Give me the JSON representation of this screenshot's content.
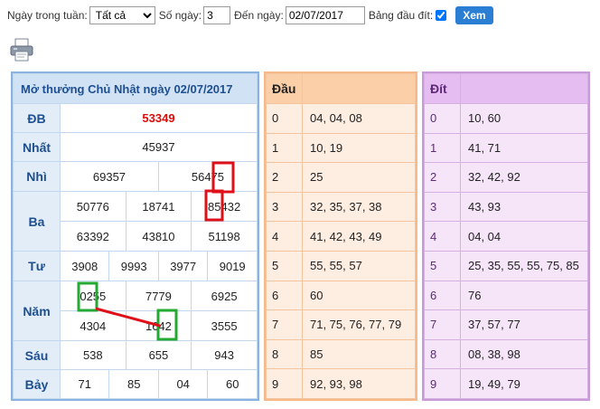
{
  "filter": {
    "day_label": "Ngày trong tuần:",
    "day_selected": "Tất cả",
    "count_label": "Số ngày:",
    "count_value": "3",
    "to_label": "Đến ngày:",
    "to_value": "02/07/2017",
    "dau_dit_label": "Bảng đầu đít:",
    "dau_dit_checked": true,
    "view_button": "Xem"
  },
  "results": {
    "title": "Mở thưởng Chủ Nhật ngày 02/07/2017",
    "prizes": {
      "db": {
        "name": "ĐB",
        "numbers": [
          "53349"
        ]
      },
      "nhat": {
        "name": "Nhất",
        "numbers": [
          "45937"
        ]
      },
      "nhi": {
        "name": "Nhì",
        "numbers": [
          "69357",
          "56475"
        ]
      },
      "ba": {
        "name": "Ba",
        "numbers": [
          "50776",
          "18741",
          "85432",
          "63392",
          "43810",
          "51198"
        ]
      },
      "tu": {
        "name": "Tư",
        "numbers": [
          "3908",
          "9993",
          "3977",
          "9019"
        ]
      },
      "nam": {
        "name": "Năm",
        "numbers": [
          "0255",
          "7779",
          "6925",
          "4304",
          "1642",
          "3555"
        ]
      },
      "sau": {
        "name": "Sáu",
        "numbers": [
          "538",
          "655",
          "943"
        ]
      },
      "bay": {
        "name": "Bảy",
        "numbers": [
          "71",
          "85",
          "04",
          "60"
        ]
      }
    }
  },
  "dau": {
    "header": "Đầu",
    "rows": [
      {
        "k": "0",
        "v": "04, 04, 08"
      },
      {
        "k": "1",
        "v": "10, 19"
      },
      {
        "k": "2",
        "v": "25"
      },
      {
        "k": "3",
        "v": "32, 35, 37, 38"
      },
      {
        "k": "4",
        "v": "41, 42, 43, 49"
      },
      {
        "k": "5",
        "v": "55, 55, 57"
      },
      {
        "k": "6",
        "v": "60"
      },
      {
        "k": "7",
        "v": "71, 75, 76, 77, 79"
      },
      {
        "k": "8",
        "v": "85"
      },
      {
        "k": "9",
        "v": "92, 93, 98"
      }
    ]
  },
  "dit": {
    "header": "Đít",
    "rows": [
      {
        "k": "0",
        "v": "10, 60"
      },
      {
        "k": "1",
        "v": "41, 71"
      },
      {
        "k": "2",
        "v": "32, 42, 92"
      },
      {
        "k": "3",
        "v": "43, 93"
      },
      {
        "k": "4",
        "v": "04, 04"
      },
      {
        "k": "5",
        "v": "25, 35, 55, 55, 75, 85"
      },
      {
        "k": "6",
        "v": "76"
      },
      {
        "k": "7",
        "v": "37, 57, 77"
      },
      {
        "k": "8",
        "v": "08, 38, 98"
      },
      {
        "k": "9",
        "v": "19, 49, 79"
      }
    ]
  },
  "colors": {
    "accent": "#2a7ed3",
    "special_prize": "#e00b0b",
    "red_mark": "#e0101a",
    "green_mark": "#22aa33"
  },
  "icons": {
    "print": "printer-icon"
  }
}
